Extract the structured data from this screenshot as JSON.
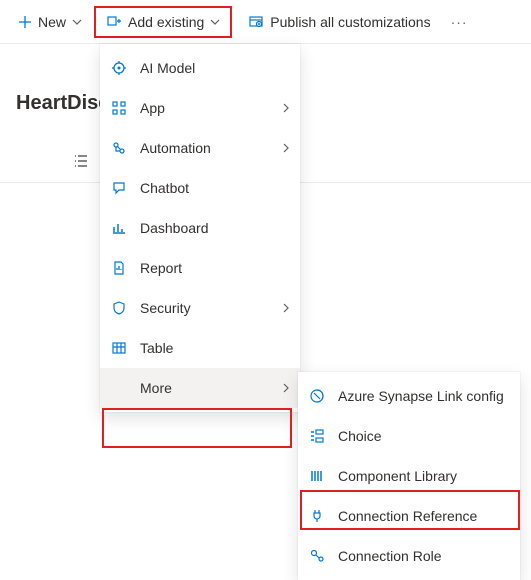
{
  "toolbar": {
    "new_label": "New",
    "add_existing_label": "Add existing",
    "publish_label": "Publish all customizations"
  },
  "page": {
    "title": "HeartDise"
  },
  "menu_main": [
    {
      "icon": "ai-model-icon",
      "label": "AI Model",
      "submenu": false
    },
    {
      "icon": "app-icon",
      "label": "App",
      "submenu": true
    },
    {
      "icon": "automation-icon",
      "label": "Automation",
      "submenu": true
    },
    {
      "icon": "chatbot-icon",
      "label": "Chatbot",
      "submenu": false
    },
    {
      "icon": "dashboard-icon",
      "label": "Dashboard",
      "submenu": false
    },
    {
      "icon": "report-icon",
      "label": "Report",
      "submenu": false
    },
    {
      "icon": "security-icon",
      "label": "Security",
      "submenu": true
    },
    {
      "icon": "table-icon",
      "label": "Table",
      "submenu": false
    },
    {
      "icon": "more-icon",
      "label": "More",
      "submenu": true,
      "hovered": true
    }
  ],
  "menu_sub": [
    {
      "icon": "synapse-icon",
      "label": "Azure Synapse Link config"
    },
    {
      "icon": "choice-icon",
      "label": "Choice"
    },
    {
      "icon": "component-library-icon",
      "label": "Component Library"
    },
    {
      "icon": "connection-reference-icon",
      "label": "Connection Reference"
    },
    {
      "icon": "connection-role-icon",
      "label": "Connection Role"
    }
  ]
}
